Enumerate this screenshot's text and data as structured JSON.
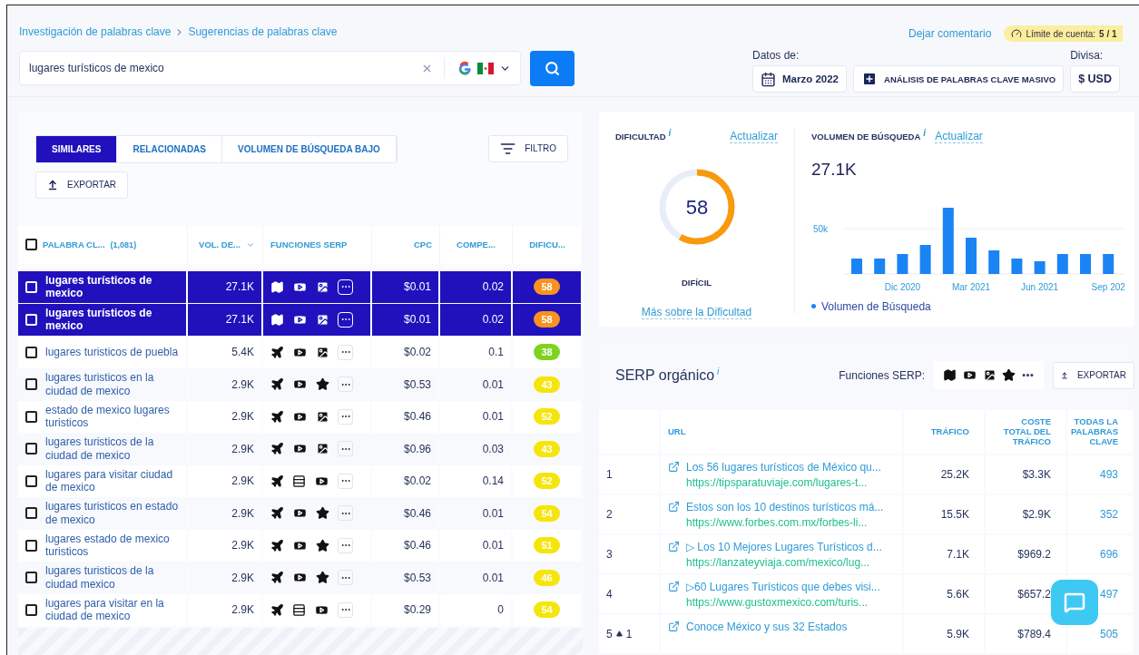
{
  "breadcrumb": {
    "items": [
      "Investigación de palabras clave",
      "Sugerencias de palabras clave"
    ]
  },
  "search": {
    "value": "lugares turísticos de mexico"
  },
  "header": {
    "feedback_link": "Dejar comentario",
    "limit_badge": "Límite de cuenta:",
    "limit_value": "5 / 1",
    "data_label": "Datos de:",
    "date_button": "Marzo 2022",
    "bulk_button": "ANÁLISIS DE PALABRAS CLAVE MASIVO",
    "currency_label": "Divisa:",
    "currency": "$ USD"
  },
  "tabs": [
    {
      "label": "SIMILARES",
      "selected": true
    },
    {
      "label": "RELACIONADAS",
      "selected": false
    },
    {
      "label": "VOLUMEN DE BÚSQUEDA BAJO",
      "selected": false
    }
  ],
  "filter_button": "FILTRO",
  "export_button": "EXPORTAR",
  "table": {
    "select_all": {
      "checked": false
    },
    "columns": [
      "PALABRA CL...",
      "(1,081)",
      "VOL. DE...",
      "FUNCIONES SERP",
      "CPC",
      "COMPE...",
      "DIFICU..."
    ],
    "rows": [
      {
        "keyword": "lugares turísticos de mexico",
        "volume": "27.1K",
        "features": [
          {
            "kind": "map"
          },
          {
            "kind": "video"
          },
          {
            "kind": "image"
          },
          {
            "kind": "more"
          }
        ],
        "cpc": "$0.01",
        "competition": "0.02",
        "difficulty": "58",
        "color": "#f7931e",
        "selected": true,
        "checked": false
      },
      {
        "keyword": "lugares turísticos de mexico",
        "volume": "27.1K",
        "features": [
          {
            "kind": "map"
          },
          {
            "kind": "video"
          },
          {
            "kind": "image"
          },
          {
            "kind": "more"
          }
        ],
        "cpc": "$0.01",
        "competition": "0.02",
        "difficulty": "58",
        "color": "#f7931e",
        "selected": true,
        "checked": false
      },
      {
        "keyword": "lugares turisticos de puebla",
        "volume": "5.4K",
        "features": [
          {
            "kind": "plane"
          },
          {
            "kind": "video"
          },
          {
            "kind": "image"
          },
          {
            "kind": "more"
          }
        ],
        "cpc": "$0.02",
        "competition": "0.1",
        "difficulty": "38",
        "color": "#7ed321",
        "selected": false,
        "checked": false
      },
      {
        "keyword": "lugares turisticos en la ciudad de mexico",
        "volume": "2.9K",
        "features": [
          {
            "kind": "plane"
          },
          {
            "kind": "video"
          },
          {
            "kind": "star"
          },
          {
            "kind": "more"
          }
        ],
        "cpc": "$0.53",
        "competition": "0.01",
        "difficulty": "43",
        "color": "#f5e50a",
        "selected": false,
        "checked": false
      },
      {
        "keyword": "estado de mexico lugares turisticos",
        "volume": "2.9K",
        "features": [
          {
            "kind": "plane"
          },
          {
            "kind": "video"
          },
          {
            "kind": "image"
          },
          {
            "kind": "more"
          }
        ],
        "cpc": "$0.46",
        "competition": "0.01",
        "difficulty": "52",
        "color": "#f5e50a",
        "selected": false,
        "checked": false
      },
      {
        "keyword": "lugares turisticos de la ciudad de mexico",
        "volume": "2.9K",
        "features": [
          {
            "kind": "plane"
          },
          {
            "kind": "video"
          },
          {
            "kind": "image"
          },
          {
            "kind": "more"
          }
        ],
        "cpc": "$0.96",
        "competition": "0.03",
        "difficulty": "43",
        "color": "#f5e50a",
        "selected": false,
        "checked": false
      },
      {
        "keyword": "lugares para visitar ciudad de mexico",
        "volume": "2.9K",
        "features": [
          {
            "kind": "plane"
          },
          {
            "kind": "list"
          },
          {
            "kind": "video"
          },
          {
            "kind": "more"
          }
        ],
        "cpc": "$0.02",
        "competition": "0.14",
        "difficulty": "52",
        "color": "#f5e50a",
        "selected": false,
        "checked": false
      },
      {
        "keyword": "lugares turisticos en estado de mexico",
        "volume": "2.9K",
        "features": [
          {
            "kind": "plane"
          },
          {
            "kind": "video"
          },
          {
            "kind": "star"
          },
          {
            "kind": "more"
          }
        ],
        "cpc": "$0.46",
        "competition": "0.01",
        "difficulty": "54",
        "color": "#f5e50a",
        "selected": false,
        "checked": false
      },
      {
        "keyword": "lugares estado de mexico turisticos",
        "volume": "2.9K",
        "features": [
          {
            "kind": "plane"
          },
          {
            "kind": "video"
          },
          {
            "kind": "star"
          },
          {
            "kind": "more"
          }
        ],
        "cpc": "$0.46",
        "competition": "0.01",
        "difficulty": "51",
        "color": "#f5e50a",
        "selected": false,
        "checked": false
      },
      {
        "keyword": "lugares turisticos de la ciudad mexico",
        "volume": "2.9K",
        "features": [
          {
            "kind": "plane"
          },
          {
            "kind": "video"
          },
          {
            "kind": "star"
          },
          {
            "kind": "more"
          }
        ],
        "cpc": "$0.53",
        "competition": "0.01",
        "difficulty": "46",
        "color": "#f5e50a",
        "selected": false,
        "checked": false
      },
      {
        "keyword": "lugares para visitar en la ciudad de mexico",
        "volume": "2.9K",
        "features": [
          {
            "kind": "plane"
          },
          {
            "kind": "list"
          },
          {
            "kind": "video"
          },
          {
            "kind": "more"
          }
        ],
        "cpc": "$0.29",
        "competition": "0",
        "difficulty": "54",
        "color": "#f5e50a",
        "selected": false,
        "checked": false
      }
    ]
  },
  "difficulty": {
    "title": "DIFICULTAD",
    "info": "i",
    "refresh": "Actualizar",
    "score": "58",
    "level": 0.58,
    "rating": "DIFÍCIL",
    "more_link": "Más sobre la Dificultad"
  },
  "volume": {
    "title": "VOLUMEN DE BÚSQUEDA",
    "info": "i",
    "refresh": "Actualizar",
    "total": "27.1K",
    "legend": "Volumen de Búsqueda",
    "y_label": "50k",
    "x_labels": [
      "Dic 2020",
      "Mar 2021",
      "Jun 2021",
      "Sep 202"
    ]
  },
  "serp": {
    "title": "SERP orgánico",
    "info": "i",
    "features_label": "Funciones SERP:",
    "features": [
      {
        "kind": "map"
      },
      {
        "kind": "video"
      },
      {
        "kind": "image"
      },
      {
        "kind": "star"
      },
      {
        "kind": "more"
      }
    ],
    "export_button": "EXPORTAR",
    "columns": [
      "URL",
      "TRÁFICO",
      "COSTE TOTAL DEL TRÁFICO",
      "TODAS LA PALABRAS CLAVE"
    ],
    "rows": [
      {
        "rank": "1",
        "title": "Los 56 lugares turísticos de México qu...",
        "url": "https://tipsparatuviaje.com/lugares-t...",
        "traffic": "25.2K",
        "cost": "$3.3K",
        "keywords": "493"
      },
      {
        "rank": "2",
        "title": "Estos son los 10 destinos turísticos má...",
        "url": "https://www.forbes.com.mx/forbes-li...",
        "traffic": "15.5K",
        "cost": "$2.9K",
        "keywords": "352"
      },
      {
        "rank": "3",
        "title": "▷ Los 10 Mejores Lugares Turísticos d...",
        "url": "https://lanzateyviaja.com/mexico/lug...",
        "traffic": "7.1K",
        "cost": "$969.2",
        "keywords": "696"
      },
      {
        "rank": "4",
        "title": "▷60 Lugares Turísticos que debes visi...",
        "url": "https://www.gustoxmexico.com/turis...",
        "traffic": "5.6K",
        "cost": "$657.2",
        "keywords": "497"
      },
      {
        "rank": "5",
        "change": "1",
        "title": "Conoce México y sus 32 Estados",
        "traffic": "5.9K",
        "cost": "$789.4",
        "keywords": "505"
      }
    ]
  }
}
